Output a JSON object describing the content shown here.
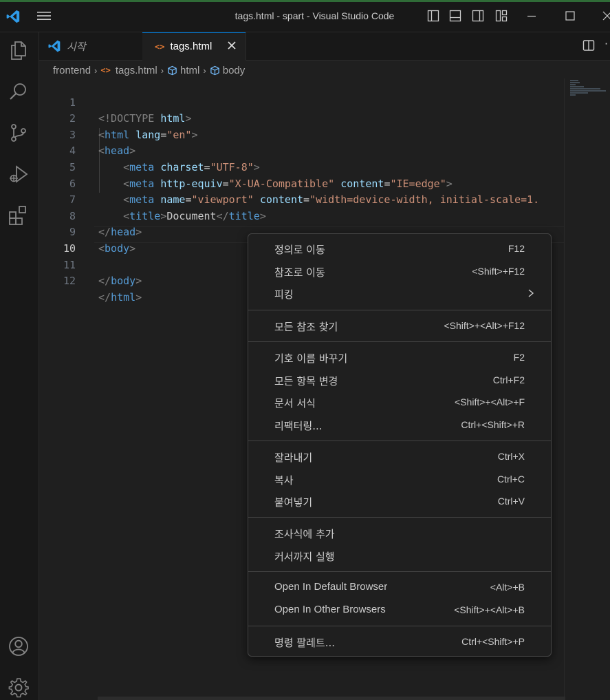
{
  "window": {
    "title": "tags.html - spart - Visual Studio Code"
  },
  "tabs": [
    {
      "label": "시작",
      "active": false
    },
    {
      "label": "tags.html",
      "active": true
    }
  ],
  "breadcrumb": {
    "folder": "frontend",
    "file": "tags.html",
    "symbol1": "html",
    "symbol2": "body"
  },
  "editor": {
    "current_line": 10,
    "lines": [
      {
        "n": "1"
      },
      {
        "n": "2"
      },
      {
        "n": "3"
      },
      {
        "n": "4"
      },
      {
        "n": "5"
      },
      {
        "n": "6"
      },
      {
        "n": "7"
      },
      {
        "n": "8"
      },
      {
        "n": "9"
      },
      {
        "n": "10"
      },
      {
        "n": "11"
      },
      {
        "n": "12"
      }
    ],
    "code": {
      "l1_doctype": "<!DOCTYPE",
      "l1_html": "html",
      "l1_close": ">",
      "l2_tag": "html",
      "l2_attr": "lang",
      "l2_val": "\"en\"",
      "l3_tag": "head",
      "l4_tag": "meta",
      "l4_attr": "charset",
      "l4_val": "\"UTF-8\"",
      "l5_tag": "meta",
      "l5_attr1": "http-equiv",
      "l5_val1": "\"X-UA-Compatible\"",
      "l5_attr2": "content",
      "l5_val2": "\"IE=edge\"",
      "l6_tag": "meta",
      "l6_attr1": "name",
      "l6_val1": "\"viewport\"",
      "l6_attr2": "content",
      "l6_val2": "\"width=device-width, initial-scale=1.",
      "l7_tag": "title",
      "l7_text": "Document",
      "l7_ctag": "title",
      "l8_tag": "head",
      "l9_tag": "body",
      "l11_tag": "body",
      "l12_tag": "html"
    }
  },
  "context_menu": {
    "groups": [
      [
        {
          "label": "정의로 이동",
          "key": "F12"
        },
        {
          "label": "참조로 이동",
          "key": "<Shift>+F12"
        },
        {
          "label": "피킹",
          "key": "",
          "submenu": true
        }
      ],
      [
        {
          "label": "모든 참조 찾기",
          "key": "<Shift>+<Alt>+F12"
        }
      ],
      [
        {
          "label": "기호 이름 바꾸기",
          "key": "F2"
        },
        {
          "label": "모든 항목 변경",
          "key": "Ctrl+F2"
        },
        {
          "label": "문서 서식",
          "key": "<Shift>+<Alt>+F"
        },
        {
          "label": "리팩터링...",
          "key": "Ctrl+<Shift>+R"
        }
      ],
      [
        {
          "label": "잘라내기",
          "key": "Ctrl+X"
        },
        {
          "label": "복사",
          "key": "Ctrl+C"
        },
        {
          "label": "붙여넣기",
          "key": "Ctrl+V"
        }
      ],
      [
        {
          "label": "조사식에 추가",
          "key": ""
        },
        {
          "label": "커서까지 실행",
          "key": ""
        }
      ],
      [
        {
          "label": "Open In Default Browser",
          "key": "<Alt>+B"
        },
        {
          "label": "Open In Other Browsers",
          "key": "<Shift>+<Alt>+B"
        }
      ],
      [
        {
          "label": "명령 팔레트...",
          "key": "Ctrl+<Shift>+P"
        }
      ]
    ]
  },
  "colors": {
    "tag": "#569cd6",
    "attribute": "#9cdcfe",
    "string": "#ce9178",
    "punctuation": "#808080",
    "accent": "#0078d4"
  },
  "icons": {
    "activity": [
      "explorer-icon",
      "search-icon",
      "source-control-icon",
      "run-debug-icon",
      "extensions-icon",
      "account-icon",
      "settings-gear-icon"
    ]
  }
}
